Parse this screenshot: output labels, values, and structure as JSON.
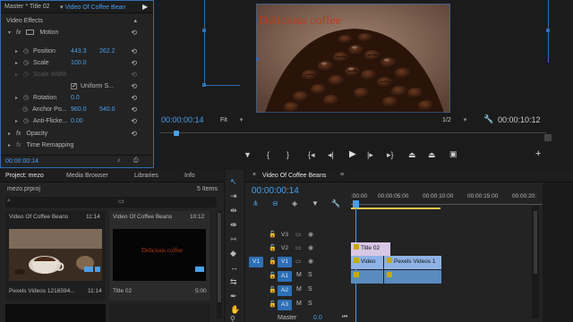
{
  "effect_controls": {
    "tab_master": "Master * Title 02",
    "tab_sequence": "Video Of Coffee Bean",
    "section": "Video Effects",
    "motion": "Motion",
    "position_label": "Position",
    "position_x": "443.3",
    "position_y": "262.2",
    "scale_label": "Scale",
    "scale_value": "100.0",
    "scale_width_label": "Scale Width",
    "uniform_scale_label": "Uniform S...",
    "rotation_label": "Rotation",
    "rotation_value": "0.0",
    "anchor_label": "Anchor Po...",
    "anchor_x": "960.0",
    "anchor_y": "540.0",
    "antiflicker_label": "Anti-Flicke...",
    "antiflicker_value": "0.00",
    "opacity": "Opacity",
    "time_remapping": "Time Remapping",
    "timecode": "00:00:00:14"
  },
  "program_monitor": {
    "video_title": "Delicious coffee",
    "timecode_left": "00:00:00:14",
    "fit": "Fit",
    "resolution": "1/2",
    "timecode_right": "00:00:10:12"
  },
  "project": {
    "tabs": [
      "Project: mezo",
      "Media Browser",
      "Libraries",
      "Info"
    ],
    "file": "mezo.prproj",
    "items_count": "5 Items",
    "bins": [
      {
        "title": "Video Of Coffee Beans",
        "duration": "11:14"
      },
      {
        "title": "Video Of Coffee Beans",
        "duration": "10:12"
      }
    ],
    "clips": [
      {
        "name": "Pexels Videos 1216594...",
        "duration": "11:14"
      },
      {
        "name": "Title 02",
        "duration": "5:00",
        "thumb_text": "Delicious coffee"
      }
    ]
  },
  "timeline": {
    "tab": "Video Of Coffee Beans",
    "timecode": "00:00:00:14",
    "ruler": [
      ":00:00",
      "00:00:05:00",
      "00:00:10:00",
      "00:00:15:00",
      "00:00:20:"
    ],
    "tracks": {
      "v3": "V3",
      "v2": "V2",
      "v1": "V1",
      "a1": "A1",
      "a2": "A2",
      "a3": "A3",
      "src_v1": "V1",
      "master": "Master",
      "master_val": "0.0"
    },
    "clip_title": "Title 02",
    "clip_video1": "Video",
    "clip_video2": "Pexels Videos 1",
    "fx": "fx"
  },
  "colors": {
    "accent": "#4a9fe8",
    "panel_border": "#2d6fb5",
    "video_clip": "#8fb3e6",
    "audio_clip": "#5a8bbf",
    "title_clip": "#d9c7e6"
  }
}
